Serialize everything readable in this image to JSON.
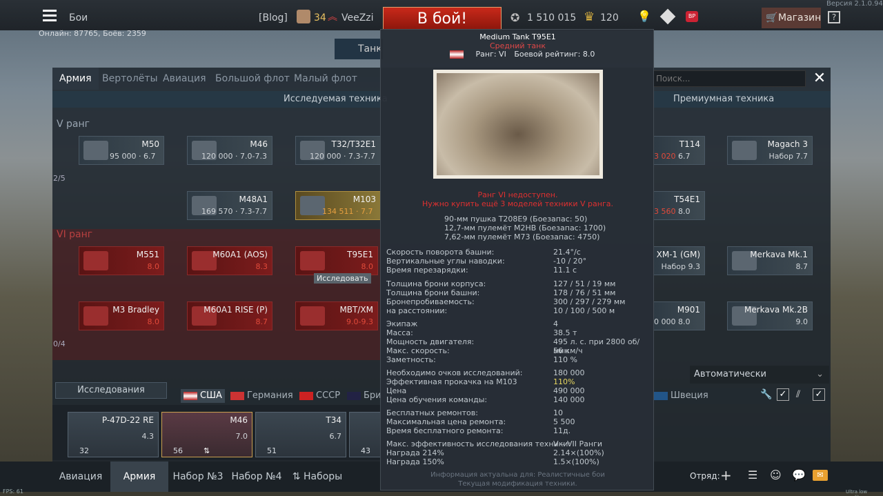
{
  "header": {
    "battles_label": "Бои",
    "blog_label": "[Blog]",
    "player_level": "34",
    "player_name": "VeeZzi",
    "play_button": "В бой!",
    "silver_lions": "1 510 015",
    "golden_eagles": "120",
    "shop_label": "Магазин",
    "help_label": "?",
    "version": "Версия 2.1.0.94",
    "online": "Онлайн: 87765, Боёв: 2359",
    "partial_label": "Танк"
  },
  "tabs": [
    "Армия",
    "Вертолёты",
    "Авиация",
    "Большой флот",
    "Малый флот"
  ],
  "search_placeholder": "Поиск...",
  "sections": {
    "researched": "Исследуемая техника",
    "premium": "Премиумная техника"
  },
  "ranks": {
    "v": "V ранг",
    "vi": "VI ранг",
    "v_progress": "2/5",
    "vi_progress": "0/4"
  },
  "tree": [
    {
      "name": "M50",
      "value": "95 000",
      "br": "6.7"
    },
    {
      "name": "M46",
      "value": "120 000",
      "br": "7.0-7.3"
    },
    {
      "name": "T32/T32E1",
      "value": "120 000",
      "br": "7.3-7.7"
    },
    {
      "name": "M48A1",
      "value": "169 570",
      "br": "7.3-7.7"
    },
    {
      "name": "M103",
      "value": "134 511",
      "br": "7.7"
    },
    {
      "name": "M551",
      "br": "8.0"
    },
    {
      "name": "M60A1 (AOS)",
      "br": "8.3"
    },
    {
      "name": "T95E1",
      "br": "8.0"
    },
    {
      "name": "M3 Bradley",
      "br": "8.0"
    },
    {
      "name": "M60A1 RISE (P)",
      "br": "8.7"
    },
    {
      "name": "MBT/XM",
      "br": "9.0-9.3"
    }
  ],
  "premium": [
    {
      "name": "T114",
      "value": "3 020",
      "br": "6.7"
    },
    {
      "name": "Magach 3",
      "br": "Набор 7.7"
    },
    {
      "name": "T54E1",
      "value": "3 560",
      "br": "8.0"
    },
    {
      "name": "XM-1 (GM)",
      "br": "Набор 9.3"
    },
    {
      "name": "Merkava Mk.1",
      "br": "8.7"
    },
    {
      "name": "M901",
      "value": "0 000",
      "br": "8.0"
    },
    {
      "name": "Merkava Mk.2B",
      "br": "9.0"
    }
  ],
  "research_hint": "Исследовать",
  "dropdown": {
    "value": "Автоматически"
  },
  "research_panel": "Исследования",
  "nations": [
    "США",
    "Германия",
    "СССР",
    "Бри",
    "Швеция"
  ],
  "crew_slots": [
    {
      "name": "P-47D-22 RE",
      "br": "4.3",
      "count": "32"
    },
    {
      "name": "M46",
      "br": "7.0",
      "count": "56"
    },
    {
      "name": "T34",
      "br": "6.7",
      "count": "51"
    },
    {
      "name": "",
      "br": "",
      "count": "43"
    }
  ],
  "bottom": [
    "Авиация",
    "Армия",
    "Набор №3",
    "Набор №4",
    "Наборы"
  ],
  "squad_label": "Отряд:",
  "fps": "FPS: 61",
  "quality": "Ultra low quality",
  "tooltip": {
    "title": "Medium Tank T95E1",
    "class": "Средний танк",
    "rank": "Ранг: VI",
    "br": "Боевой рейтинг: 8.0",
    "locked1": "Ранг VI недоступен.",
    "locked2": "Нужно купить ещё 3 моделей техники V ранга.",
    "weapons": [
      "90-мм пушка T208E9 (Боезапас: 50)",
      "12,7-мм пулемёт M2HB (Боезапас: 1700)",
      "7,62-мм пулемёт M73 (Боезапас: 4750)"
    ],
    "stats": [
      [
        "Скорость поворота башни:",
        "21.4°/с"
      ],
      [
        "Вертикальные углы наводки:",
        "-10 / 20°"
      ],
      [
        "Время перезарядки:",
        "11.1 с"
      ],
      [
        "Толщина брони корпуса:",
        "127 / 51 / 19 мм"
      ],
      [
        "Толщина брони башни:",
        "178 / 76 / 51 мм"
      ],
      [
        "Бронепробиваемость:",
        "300 / 297 / 279 мм"
      ],
      [
        "на расстоянии:",
        "10 / 100 / 500 м"
      ],
      [
        "Экипаж",
        "4"
      ],
      [
        "Масса:",
        "38.5 т"
      ],
      [
        "Мощность двигателя:",
        "495 л. с. при 2800 об/мин"
      ],
      [
        "Макс. скорость:",
        "56 км/ч"
      ],
      [
        "Заметность:",
        "110 %"
      ],
      [
        "Необходимо очков исследований:",
        "180 000"
      ],
      [
        "Эффективная прокачка на M103",
        "110%"
      ],
      [
        "Цена",
        "490 000"
      ],
      [
        "Цена обучения команды:",
        "140 000"
      ],
      [
        "Бесплатных ремонтов:",
        "10"
      ],
      [
        "Максимальная цена ремонта:",
        "5 500"
      ],
      [
        "Время бесплатного ремонта:",
        "11д."
      ],
      [
        "Макс. эффективность исследования техники:",
        "V – VII Ранги"
      ],
      [
        "Награда 214%",
        "2.14×(100%)"
      ],
      [
        "Награда 150%",
        "1.5×(100%)"
      ]
    ],
    "footer1": "Информация актуальна для: Реалистичные бои",
    "footer2": "Текущая модификация техники."
  }
}
